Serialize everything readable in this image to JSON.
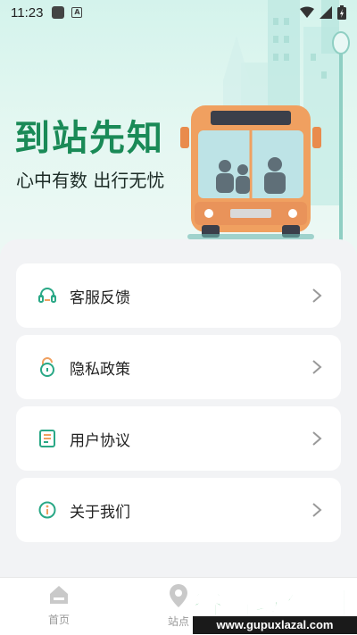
{
  "status_bar": {
    "time": "11:23",
    "icons": [
      "notification-icon",
      "accessibility-icon",
      "wifi-icon",
      "signal-icon",
      "battery-icon"
    ]
  },
  "hero": {
    "headline": "到站先知",
    "subline": "心中有数 出行无忧",
    "accent_color": "#1a8a57"
  },
  "menu": {
    "items": [
      {
        "label": "客服反馈",
        "icon": "headset-icon"
      },
      {
        "label": "隐私政策",
        "icon": "lock-icon"
      },
      {
        "label": "用户协议",
        "icon": "document-icon"
      },
      {
        "label": "关于我们",
        "icon": "info-icon"
      }
    ]
  },
  "tabbar": {
    "tabs": [
      {
        "label": "首页",
        "icon": "home-icon"
      },
      {
        "label": "站点",
        "icon": "location-pin-icon"
      }
    ]
  },
  "watermark": {
    "title": "谷普软件园",
    "url": "www.gupuxlazal.com"
  }
}
